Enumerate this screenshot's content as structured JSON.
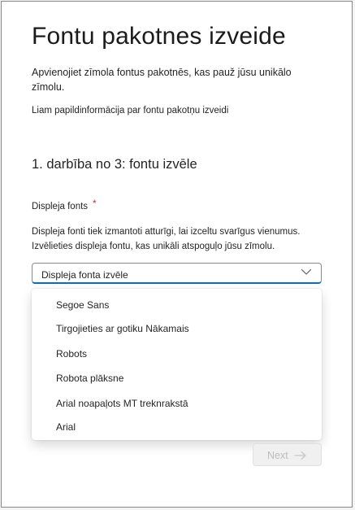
{
  "page": {
    "title": "Fontu pakotnes izveide",
    "intro": "Apvienojiet zīmola fontus pakotnēs, kas pauž jūsu unikālo zīmolu.",
    "learn_more": "Liam papildinformācija par fontu pakotņu izveidi"
  },
  "step": {
    "label": "1. darbība no 3: fontu izvēle"
  },
  "display_font": {
    "label": "Displeja fonts",
    "required_marker": "*",
    "description": "Displeja fonti tiek izmantoti atturīgi, lai izceltu svarīgus vienumus. Izvēlieties displeja fontu, kas unikāli atspoguļo jūsu zīmolu.",
    "select_placeholder": "Displeja fonta izvēle",
    "options": [
      "Segoe Sans",
      "Tirgojieties ar gotiku Nākamais",
      "Robots",
      "Robota plāksne",
      "Arial noapaļots MT treknrakstā",
      "Arial"
    ]
  },
  "footer": {
    "next_label": "Next",
    "next_enabled": false
  },
  "icons": {
    "select_chevron": "chevron-down-icon",
    "next_arrow": "arrow-right-icon"
  },
  "colors": {
    "accent": "#0f6cbd",
    "required": "#c4314b",
    "disabled_text": "#bdbdbd"
  }
}
